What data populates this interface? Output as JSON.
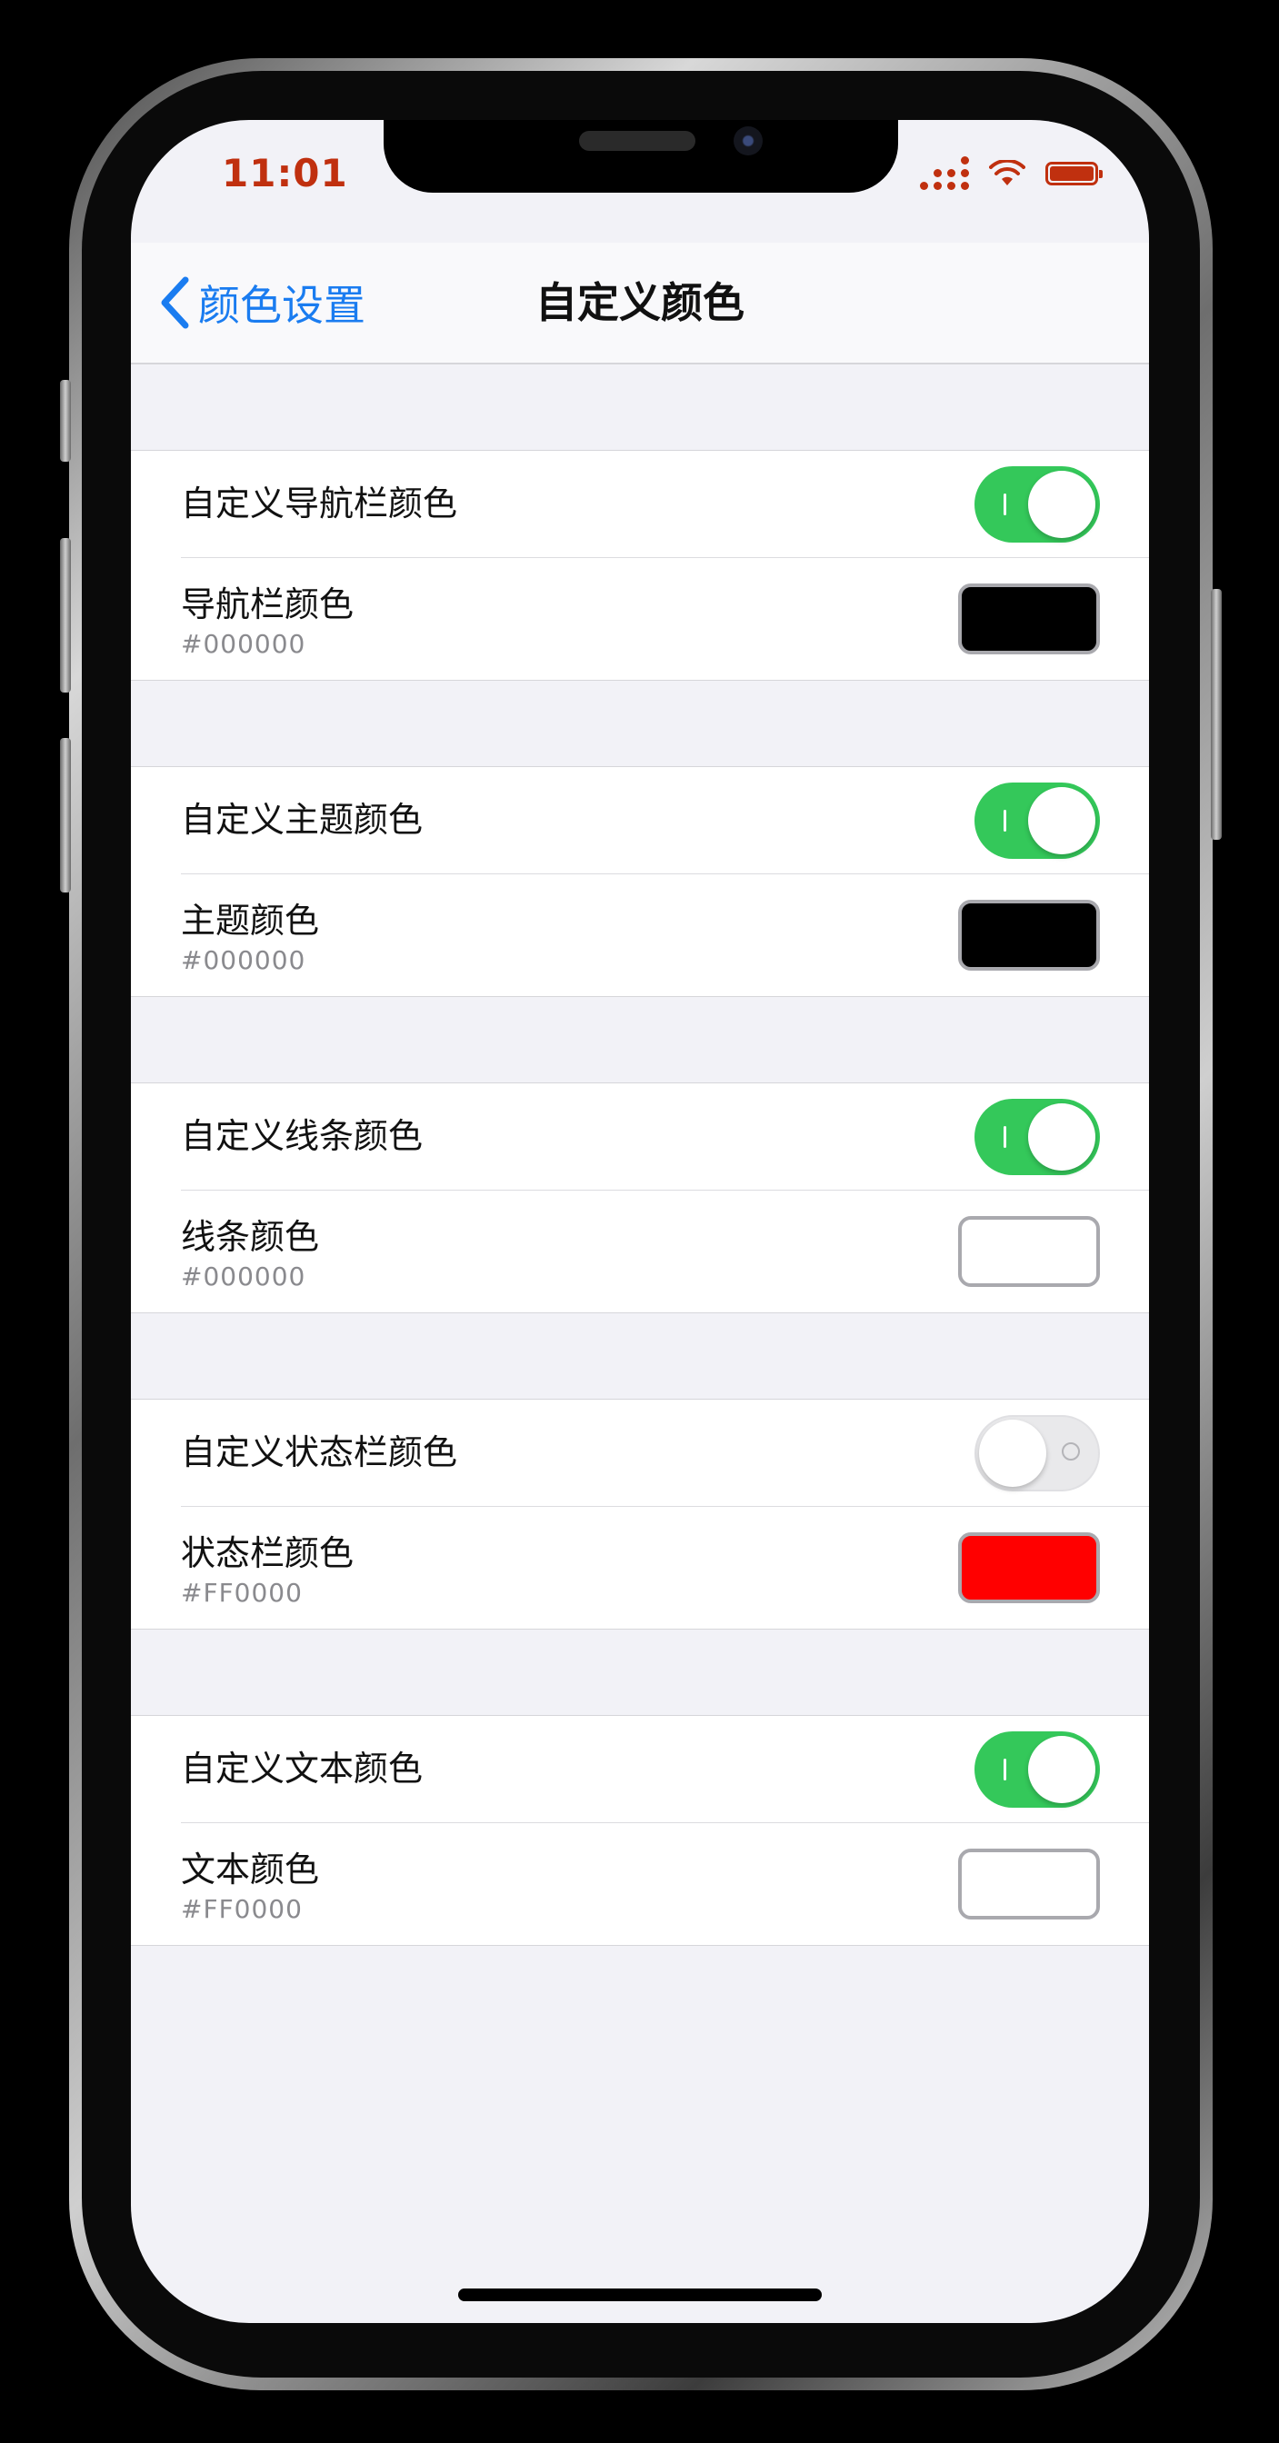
{
  "status_bar": {
    "time": "11:01",
    "color": "#C0300F"
  },
  "nav": {
    "back_label": "颜色设置",
    "title": "自定义颜色",
    "accent": "#1A7CF0"
  },
  "sections": [
    {
      "switch_label": "自定义导航栏颜色",
      "switch_on": true,
      "color_label": "导航栏颜色",
      "color_hex": "#000000",
      "swatch_color": "#000000"
    },
    {
      "switch_label": "自定义主题颜色",
      "switch_on": true,
      "color_label": "主题颜色",
      "color_hex": "#000000",
      "swatch_color": "#000000"
    },
    {
      "switch_label": "自定义线条颜色",
      "switch_on": true,
      "color_label": "线条颜色",
      "color_hex": "#000000",
      "swatch_color": "#FFFFFF"
    },
    {
      "switch_label": "自定义状态栏颜色",
      "switch_on": false,
      "color_label": "状态栏颜色",
      "color_hex": "#FF0000",
      "swatch_color": "#FF0000"
    },
    {
      "switch_label": "自定义文本颜色",
      "switch_on": true,
      "color_label": "文本颜色",
      "color_hex": "#FF0000",
      "swatch_color": "#FFFFFF"
    }
  ],
  "switch_on_color": "#34C85A"
}
